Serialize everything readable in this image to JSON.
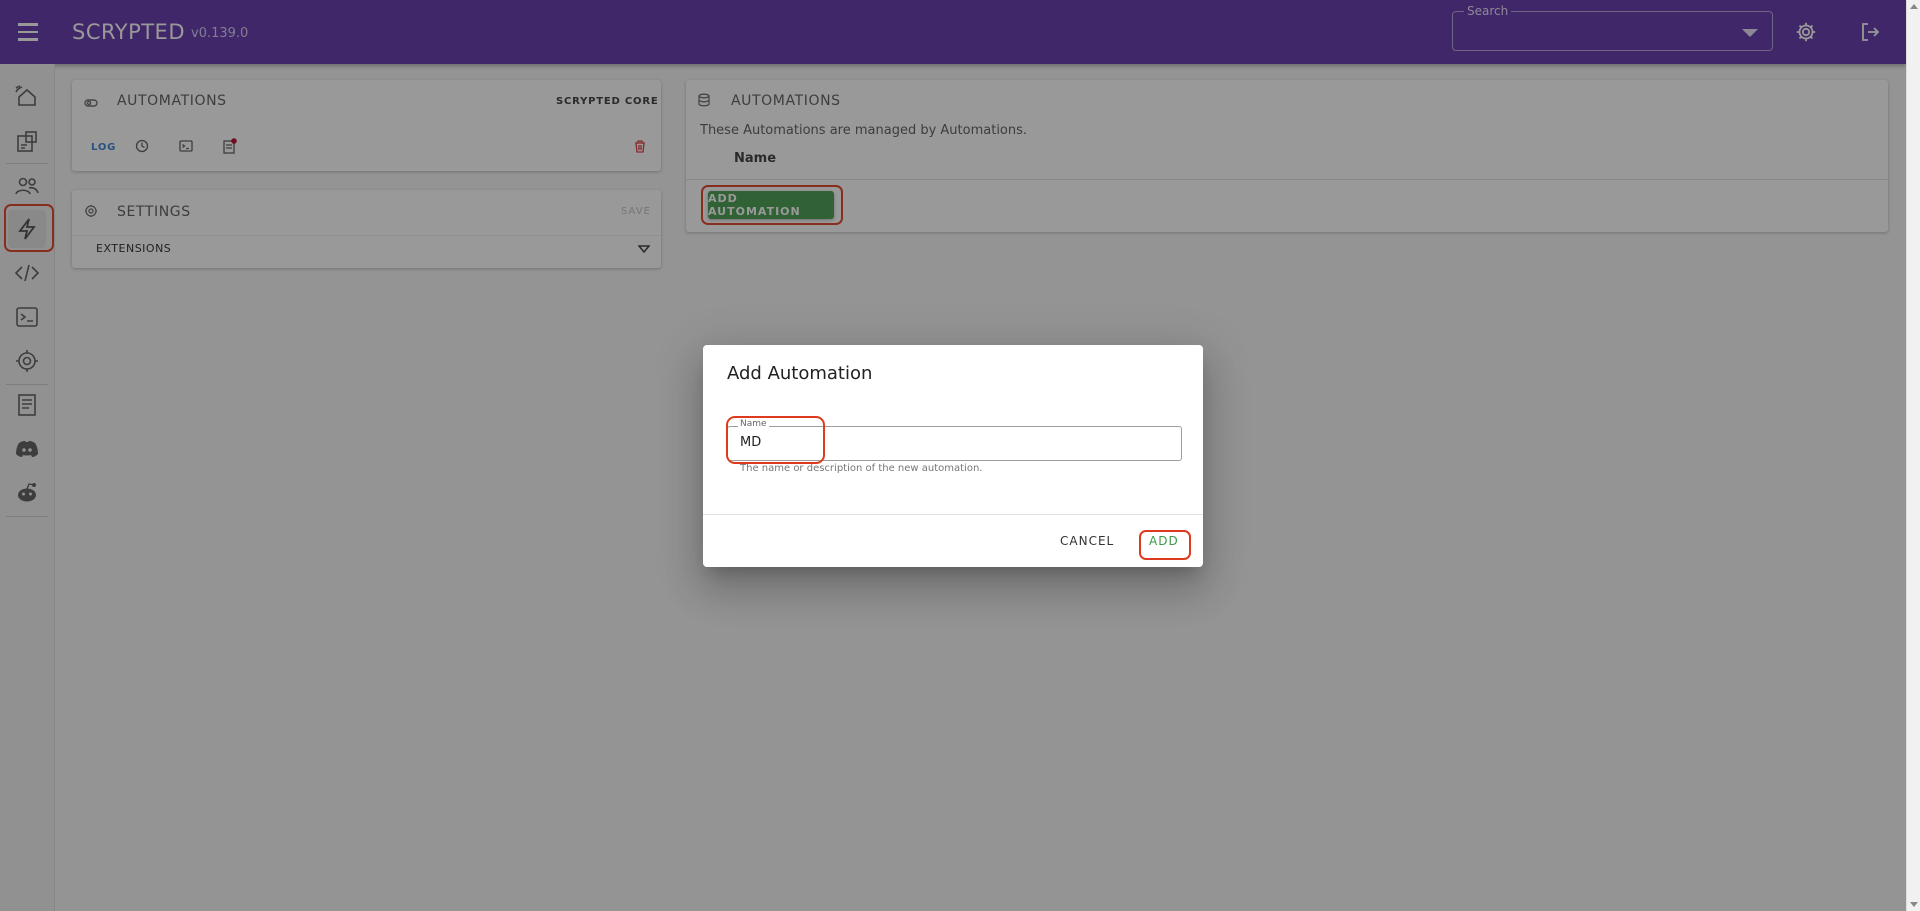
{
  "app": {
    "brand": "SCRYPTED",
    "version": "v0.139.0",
    "search_label": "Search",
    "search_value": ""
  },
  "sidebar": {
    "items": [
      {
        "icon": "remote-home-icon"
      },
      {
        "icon": "devices-icon"
      },
      {
        "icon": "users-icon"
      },
      {
        "icon": "automation-bolt-icon",
        "selected": true
      },
      {
        "icon": "code-icon"
      },
      {
        "icon": "terminal-icon"
      },
      {
        "icon": "settings-gear-icon"
      },
      {
        "icon": "docs-icon"
      },
      {
        "icon": "discord-icon"
      },
      {
        "icon": "reddit-icon"
      }
    ]
  },
  "plugin_card": {
    "title": "AUTOMATIONS",
    "subtitle": "SCRYPTED CORE",
    "log_label": "LOG"
  },
  "settings_card": {
    "title": "SETTINGS",
    "save_label": "SAVE",
    "extensions_label": "EXTENSIONS"
  },
  "automations_card": {
    "title": "AUTOMATIONS",
    "description": "These Automations are managed by Automations.",
    "column_name": "Name",
    "add_button": "ADD AUTOMATION"
  },
  "dialog": {
    "title": "Add Automation",
    "field_label": "Name",
    "field_value": "MD",
    "field_hint": "The name or description of the new automation.",
    "cancel_label": "CANCEL",
    "add_label": "ADD"
  },
  "colors": {
    "topbar": "#5a2ea6",
    "accent_green": "#3d9a47",
    "highlight_red": "#e03a1e",
    "log_blue": "#2f7fd0"
  }
}
